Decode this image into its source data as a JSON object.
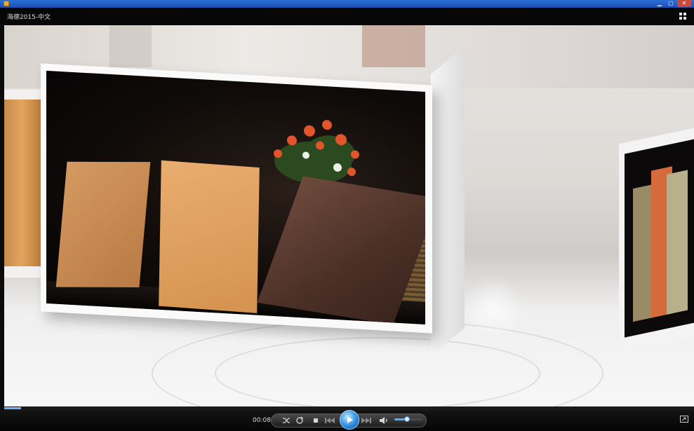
{
  "window": {
    "title": "海德2015-中文",
    "controls": {
      "minimize": "▁",
      "maximize": "▢",
      "close": "✕"
    }
  },
  "player": {
    "current_time": "00:08",
    "progress_fraction": 0.024,
    "volume_fraction": 0.45,
    "state": "paused"
  },
  "icons": {
    "app": "app-icon",
    "fullscreen": "fullscreen-icon",
    "shuffle": "shuffle-icon",
    "repeat": "repeat-icon",
    "stop": "stop-icon",
    "previous": "previous-icon",
    "play": "play-icon",
    "next": "next-icon",
    "volume": "volume-icon",
    "switch_view": "switch-to-library-icon"
  },
  "colors": {
    "accent": "#2c8ee0",
    "titlebar": "#070707",
    "caption": "#1b4fb3"
  }
}
